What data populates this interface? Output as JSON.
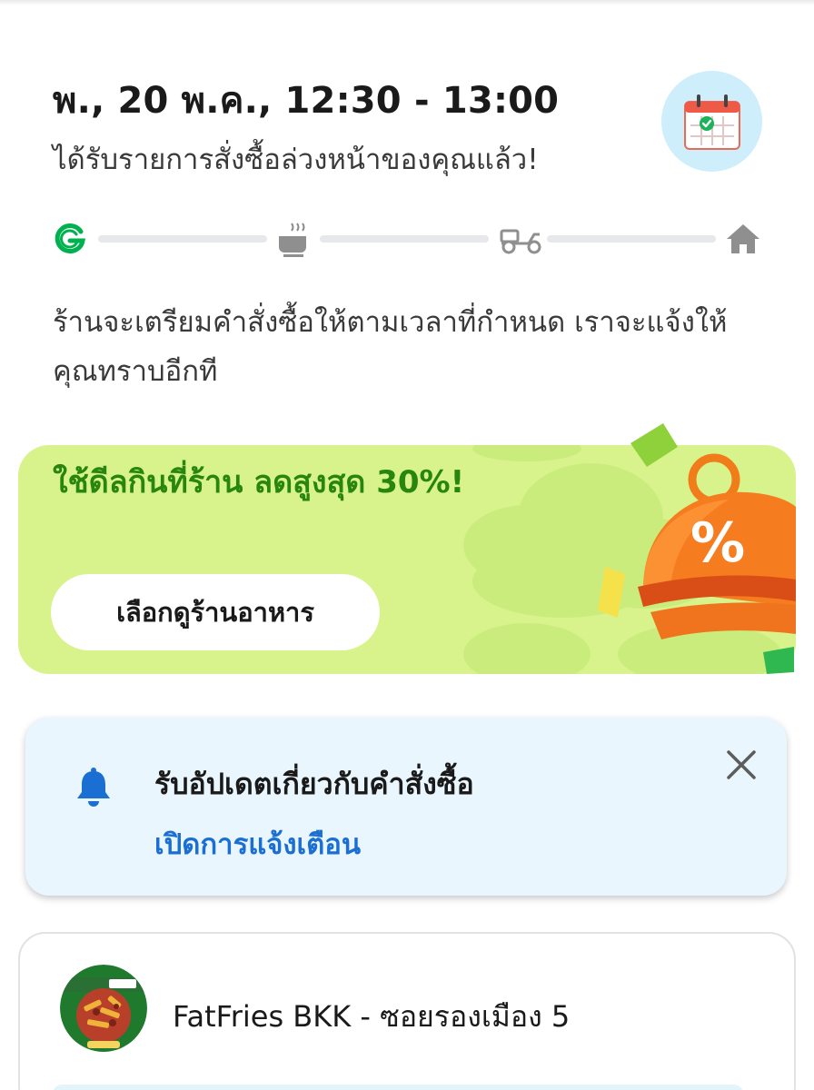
{
  "order": {
    "time": "พ., 20 พ.ค., 12:30 - 13:00",
    "status": "ได้รับรายการสั่งซื้อล่วงหน้าของคุณแล้ว!",
    "prep_message": "ร้านจะเตรียมคำสั่งซื้อให้ตามเวลาที่กำหนด เราจะแจ้งให้คุณทราบอีกที"
  },
  "progress": {
    "steps": [
      "grab-logo-icon",
      "cooking-pot-icon",
      "scooter-icon",
      "home-icon"
    ],
    "active_step": 0
  },
  "promo": {
    "title": "ใช้ดีลกินที่ร้าน ลดสูงสุด 30%!",
    "button_label": "เลือกดูร้านอาหาร",
    "badge_symbol": "%"
  },
  "notification": {
    "title": "รับอัปเดตเกี่ยวกับคำสั่งซื้อ",
    "link": "เปิดการแจ้งเตือน"
  },
  "store": {
    "name": "FatFries BKK - ซอยรองเมือง 5"
  },
  "colors": {
    "grab_green": "#00b14f",
    "promo_bg": "#d8f38c",
    "promo_text": "#28850e",
    "link_blue": "#1b6fd3",
    "notify_bg": "#e9f6fd",
    "badge_bg": "#cdeefa"
  }
}
